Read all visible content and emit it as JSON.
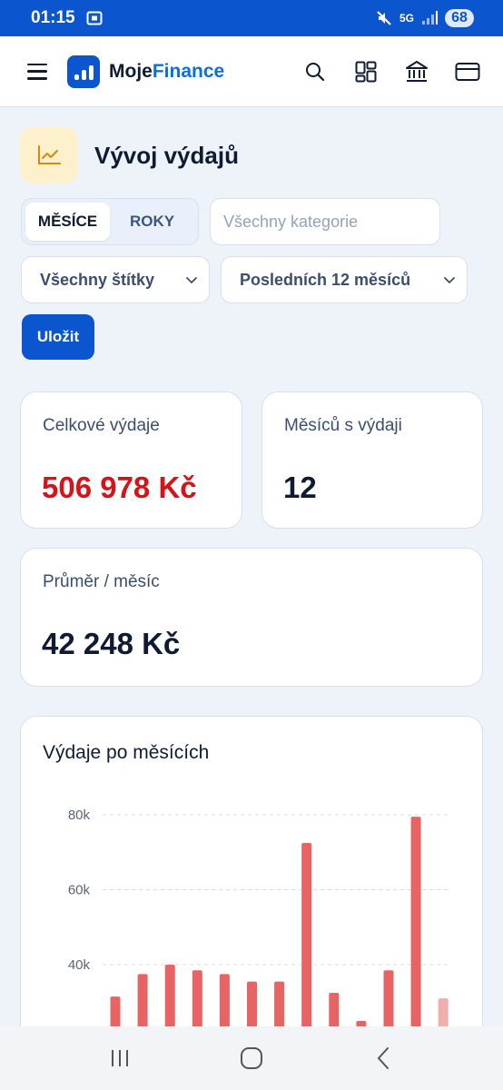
{
  "status_bar": {
    "time": "01:15",
    "network": "5G",
    "battery": "68"
  },
  "app": {
    "brand_part1": "Moje",
    "brand_part2": "Finance",
    "icons": [
      "menu-icon",
      "search-icon",
      "dashboard-icon",
      "bank-icon",
      "card-icon"
    ]
  },
  "page": {
    "title": "Vývoj výdajů",
    "icon": "line-chart-icon"
  },
  "controls": {
    "segment": [
      {
        "label": "MĚSÍCE",
        "active": true
      },
      {
        "label": "ROKY",
        "active": false
      }
    ],
    "category_placeholder": "Všechny kategorie",
    "tags_select": "Všechny štítky",
    "range_select": "Posledních 12 měsíců",
    "save_label": "Uložit"
  },
  "stats": {
    "total_label": "Celkové výdaje",
    "total_value": "506 978 Kč",
    "months_label": "Měsíců s výdaji",
    "months_value": "12",
    "avg_label": "Průměr / měsíc",
    "avg_value": "42 248 Kč"
  },
  "colors": {
    "primary": "#0b55cf",
    "expense_red": "#d4131b",
    "bar": "#e86464",
    "bar_light": "#f2adad"
  },
  "chart_data": {
    "type": "bar",
    "title": "Výdaje po měsících",
    "yticks": [
      "80k",
      "60k",
      "40k"
    ],
    "ytick_values": [
      80000,
      60000,
      40000
    ],
    "values": [
      31500,
      37500,
      40000,
      38500,
      37500,
      35500,
      35500,
      72500,
      32500,
      25000,
      38500,
      79500,
      31000
    ],
    "highlight_last": true,
    "grid": true
  }
}
